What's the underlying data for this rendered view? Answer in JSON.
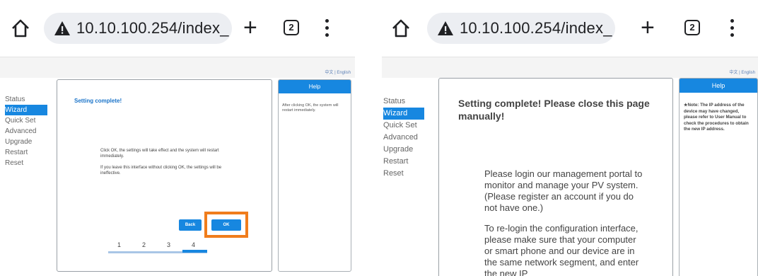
{
  "left": {
    "browser": {
      "url": "10.10.100.254/index_",
      "tab_count": "2"
    },
    "lang_switch": "中文 | English",
    "nav": [
      {
        "label": "Status",
        "active": false
      },
      {
        "label": "Wizard",
        "active": true
      },
      {
        "label": "Quick Set",
        "active": false
      },
      {
        "label": "Advanced",
        "active": false
      },
      {
        "label": "Upgrade",
        "active": false
      },
      {
        "label": "Restart",
        "active": false
      },
      {
        "label": "Reset",
        "active": false
      }
    ],
    "content": {
      "title": "Setting complete!",
      "paragraph1": "Click OK, the settings will take effect and the system will restart immediately.",
      "paragraph2": "If you leave this interface without clicking OK, the settings will be ineffective.",
      "back_label": "Back",
      "ok_label": "OK",
      "steps": [
        "1",
        "2",
        "3",
        "4"
      ],
      "current_step": 4
    },
    "help": {
      "title": "Help",
      "text": "After clicking OK, the system will restart immediately."
    }
  },
  "right": {
    "browser": {
      "url": "10.10.100.254/index_",
      "tab_count": "2"
    },
    "lang_switch": "中文 | English",
    "nav": [
      {
        "label": "Status",
        "active": false
      },
      {
        "label": "Wizard",
        "active": true
      },
      {
        "label": "Quick Set",
        "active": false
      },
      {
        "label": "Advanced",
        "active": false
      },
      {
        "label": "Upgrade",
        "active": false
      },
      {
        "label": "Restart",
        "active": false
      },
      {
        "label": "Reset",
        "active": false
      }
    ],
    "content": {
      "title": "Setting complete! Please close this page manually!",
      "paragraph1": "Please login our management portal to monitor and manage your PV system.(Please register an account if you do not have one.)",
      "paragraph2": "To re-login the configuration interface, please make sure that your computer or smart phone and our device are in the same network segment, and enter the new IP"
    },
    "help": {
      "title": "Help",
      "text": "★Note: The IP address of the device may have changed, please refer to User Manual to check the procedures to obtain the new IP address."
    }
  },
  "colors": {
    "accent": "#1787e0",
    "highlight": "#f07d1c",
    "pill": "#eceef2"
  },
  "icons": [
    "home-icon",
    "warning-icon",
    "new-tab-icon",
    "tab-switcher-icon",
    "menu-icon"
  ]
}
